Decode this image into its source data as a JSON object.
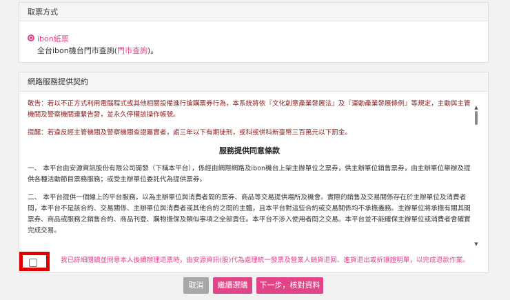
{
  "ticket_section": {
    "title": "取票方式",
    "option_label": "ibon紙票",
    "option_desc_prefix": "全台ibon機台門市查詢(",
    "option_desc_link": "門市查詢",
    "option_desc_suffix": ")。"
  },
  "contract_section": {
    "title": "網路服務提供契約",
    "warning_1": "敬告：若以不正方式利用電腦程式或其他相關設備進行搶購票券行為，本系統將依『文化創意產業發展法』及『運動產業發展條例』等規定，主動與主管機關及警察機關連繫告發，並永久停權該操作帳號。",
    "warning_2": "提醒：若違反經主管機關及警察機關查證屬實者，處三年以下有期徒刑，或科或併科新臺幣三百萬元以下罰金。",
    "terms_title": "服務提供同意條款",
    "clause_1": "一、 本平台由安源資訊股份有限公司開發（下稱本平台），係經由網際網路及ibon機台上架主辦單位之票券，供主辦單位銷售票券，由主辦單位舉辦及提供各種活動節目票務服務；或受主辦單位委託代為提供票券。",
    "clause_2": "二、 本平台提供一個線上的平台服務，以為主辦單位與消費者間的票券、商品等交易提供場所及機會。實際的銷售及交易關係存在於主辦單位及消費者間，本平台不是該合約、交易關係、主辦單位與消費者或其他合約之間的主體，且本平台對這些合約或交易關係均不承擔義務。主辦單位將承擔有關其開票券、商品或服務之銷售合約、商品刊登、購物擔保及類似事項之全部責任。本平台不涉入使用者間之交易。本平台並不能確保主辦單位或消費者會確實完成交易。",
    "agree_text": "我已詳細閱讀並同意本人後續辦理退票時，由安源資訊(股)代為處理統一發票及營業人銷貨退回、進貨退出或折讓證明單，以完成退款作業。"
  },
  "buttons": {
    "cancel": "取消",
    "continue": "繼續選購",
    "next": "下一步，核對資料"
  },
  "colors": {
    "accent": "#e2448a",
    "warning_text": "#8b1e1e",
    "highlight_box": "#e00000",
    "cancel_bg": "#a7a7a7"
  },
  "icons": {
    "scroll_up": "▲",
    "scroll_down": "▼"
  }
}
